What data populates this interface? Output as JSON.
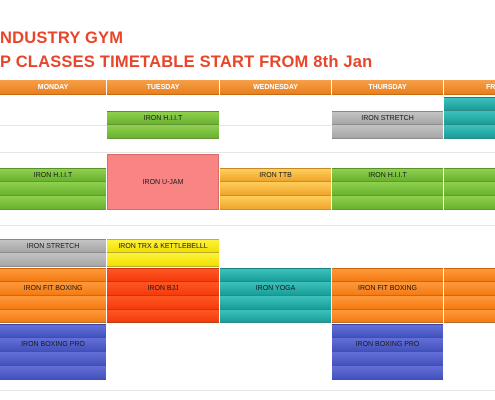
{
  "header": {
    "title_line1": "NDUSTRY GYM",
    "title_line2": "P CLASSES TIMETABLE START FROM 8th Jan"
  },
  "days": [
    "MONDAY",
    "TUESDAY",
    "WEDNESDAY",
    "THURSDAY",
    "FR"
  ],
  "colors": {
    "title": "#e8452a",
    "header_orange": "#f39330",
    "iron_hiit_green": "#7ac143",
    "iron_u_jam_pink": "#f98484",
    "iron_ttb_orange": "#f8b844",
    "iron_stretch_grey": "#b3b3b3",
    "iron_yoga_teal": "#2bb0ab",
    "iron_trx_yellow": "#f8ea1c",
    "iron_bjj_red": "#f94a17",
    "iron_fit_boxing_orange": "#f78a26",
    "iron_boxing_pro_blue": "#5361c9"
  },
  "classes": {
    "tue_hiit": "IRON H.I.I.T",
    "thu_stretch": "IRON STRETCH",
    "mon_hiit": "IRON H.I.I.T",
    "tue_ujam": "IRON U-JAM",
    "wed_ttb": "IRON TTB",
    "thu_hiit": "IRON H.I.I.T",
    "mon_stretch": "IRON STRETCH",
    "tue_trx": "IRON TRX & KETTLEBELLL",
    "mon_fitboxing": "IRON FIT BOXING",
    "tue_bjj": "IRON BJJ",
    "wed_yoga": "IRON YOGA",
    "thu_fitboxing": "IRON FIT BOXING",
    "mon_boxingpro": "IRON BOXING PRO",
    "thu_boxingpro": "IRON BOXING PRO"
  }
}
